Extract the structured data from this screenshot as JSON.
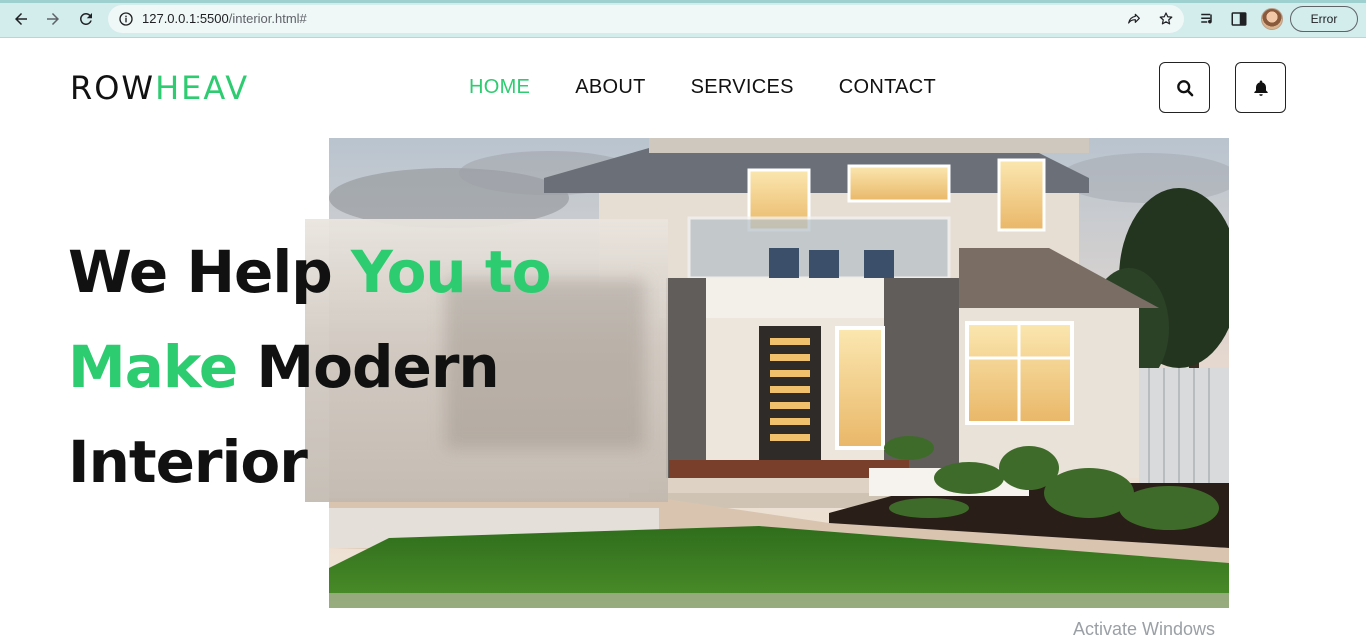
{
  "browser": {
    "url_host": "127.0.0.1:5500",
    "url_path": "/interior.html#",
    "profile_status": "Error"
  },
  "site": {
    "logo_part1": "ROW",
    "logo_part2": "HEAV",
    "nav": [
      "HOME",
      "ABOUT",
      "SERVICES",
      "CONTACT"
    ],
    "active_nav": "HOME",
    "accent_color": "#2ecc71"
  },
  "hero": {
    "line1_dark": "We Help ",
    "line1_green": "You to",
    "line2_green": "Make",
    "line2_dark": " Modern",
    "line3_dark": "Interior"
  },
  "os": {
    "watermark": "Activate Windows"
  },
  "icons": {
    "search": "search-icon",
    "bell": "bell-icon"
  }
}
